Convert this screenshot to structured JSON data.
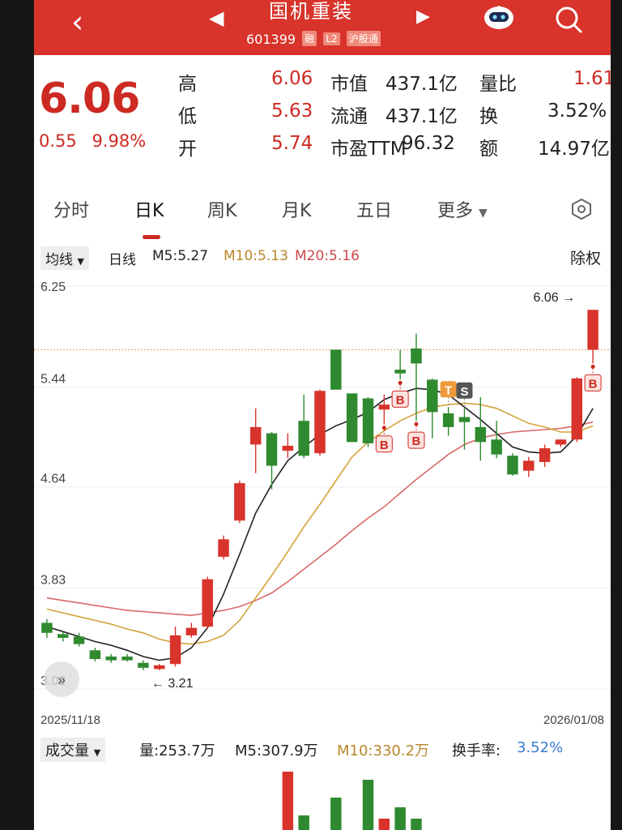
{
  "header": {
    "title": "国机重装",
    "code": "601399",
    "badges": [
      "融",
      "L2",
      "沪股通"
    ]
  },
  "quote": {
    "price": "6.06",
    "change": "0.55",
    "change_pct": "9.98%",
    "high_label": "高",
    "high": "6.06",
    "low_label": "低",
    "low": "5.63",
    "open_label": "开",
    "open": "5.74",
    "mktcap_label": "市值",
    "mktcap": "437.1亿",
    "float_label": "流通",
    "float": "437.1亿",
    "pe_label": "市盈TTM",
    "pe": "96.32",
    "volratio_label": "量比",
    "volratio": "1.61",
    "turnover_label": "换",
    "turnover": "3.52%",
    "amount_label": "额",
    "amount": "14.97亿"
  },
  "tabs": [
    "分时",
    "日K",
    "周K",
    "月K",
    "五日",
    "更多"
  ],
  "ma_bar": {
    "button": "均线",
    "period": "日线",
    "m5": "M5:5.27",
    "m10": "M10:5.13",
    "m20": "M20:5.16",
    "adjust": "除权"
  },
  "chart_data": {
    "type": "candlestick",
    "y_ticks": [
      "6.25",
      "5.44",
      "4.64",
      "3.83",
      "3.02"
    ],
    "ylim": [
      3.02,
      6.25
    ],
    "x_start_label": "2025/11/18",
    "x_end_label": "2026/01/08",
    "max_annotation": "6.06",
    "min_annotation": "3.21",
    "reference_line": 5.74,
    "candles": [
      {
        "o": 3.55,
        "c": 3.47,
        "h": 3.58,
        "l": 3.43
      },
      {
        "o": 3.46,
        "c": 3.43,
        "h": 3.48,
        "l": 3.4
      },
      {
        "o": 3.44,
        "c": 3.38,
        "h": 3.47,
        "l": 3.36
      },
      {
        "o": 3.33,
        "c": 3.26,
        "h": 3.35,
        "l": 3.24
      },
      {
        "o": 3.28,
        "c": 3.25,
        "h": 3.3,
        "l": 3.23
      },
      {
        "o": 3.28,
        "c": 3.25,
        "h": 3.3,
        "l": 3.24
      },
      {
        "o": 3.23,
        "c": 3.19,
        "h": 3.25,
        "l": 3.17
      },
      {
        "o": 3.18,
        "c": 3.21,
        "h": 3.22,
        "l": 3.17
      },
      {
        "o": 3.22,
        "c": 3.45,
        "h": 3.52,
        "l": 3.2
      },
      {
        "o": 3.45,
        "c": 3.51,
        "h": 3.55,
        "l": 3.43
      },
      {
        "o": 3.52,
        "c": 3.9,
        "h": 3.92,
        "l": 3.5
      },
      {
        "o": 4.08,
        "c": 4.22,
        "h": 4.25,
        "l": 4.06
      },
      {
        "o": 4.37,
        "c": 4.67,
        "h": 4.69,
        "l": 4.35
      },
      {
        "o": 4.98,
        "c": 5.12,
        "h": 5.27,
        "l": 4.75
      },
      {
        "o": 5.07,
        "c": 4.81,
        "h": 5.08,
        "l": 4.62
      },
      {
        "o": 4.93,
        "c": 4.97,
        "h": 5.07,
        "l": 4.87
      },
      {
        "o": 5.17,
        "c": 4.89,
        "h": 5.38,
        "l": 4.87
      },
      {
        "o": 4.91,
        "c": 5.41,
        "h": 5.42,
        "l": 4.89
      },
      {
        "o": 5.74,
        "c": 5.42,
        "h": 5.74,
        "l": 5.42
      },
      {
        "o": 5.39,
        "c": 5.0,
        "h": 5.39,
        "l": 5.0
      },
      {
        "o": 5.35,
        "c": 4.99,
        "h": 5.36,
        "l": 4.96
      },
      {
        "o": 5.26,
        "c": 5.3,
        "h": 5.38,
        "l": 5.14
      },
      {
        "o": 5.58,
        "c": 5.55,
        "h": 5.74,
        "l": 5.5
      },
      {
        "o": 5.75,
        "c": 5.63,
        "h": 5.87,
        "l": 5.17
      },
      {
        "o": 5.5,
        "c": 5.24,
        "h": 5.51,
        "l": 5.03
      },
      {
        "o": 5.23,
        "c": 5.12,
        "h": 5.28,
        "l": 5.05
      },
      {
        "o": 5.2,
        "c": 5.16,
        "h": 5.27,
        "l": 4.94
      },
      {
        "o": 5.12,
        "c": 5.0,
        "h": 5.36,
        "l": 4.85
      },
      {
        "o": 5.02,
        "c": 4.9,
        "h": 5.17,
        "l": 4.87
      },
      {
        "o": 4.89,
        "c": 4.74,
        "h": 4.91,
        "l": 4.73
      },
      {
        "o": 4.77,
        "c": 4.85,
        "h": 4.88,
        "l": 4.72
      },
      {
        "o": 4.84,
        "c": 4.95,
        "h": 4.98,
        "l": 4.8
      },
      {
        "o": 4.98,
        "c": 5.02,
        "h": 5.02,
        "l": 4.96
      },
      {
        "o": 5.02,
        "c": 5.51,
        "h": 5.52,
        "l": 5.0
      },
      {
        "o": 5.74,
        "c": 6.06,
        "h": 6.06,
        "l": 5.63
      }
    ],
    "ma5": [
      3.52,
      3.48,
      3.44,
      3.4,
      3.37,
      3.33,
      3.28,
      3.25,
      3.27,
      3.35,
      3.51,
      3.78,
      4.1,
      4.43,
      4.66,
      4.85,
      4.96,
      5.06,
      5.13,
      5.18,
      5.24,
      5.34,
      5.39,
      5.43,
      5.42,
      5.38,
      5.28,
      5.18,
      5.07,
      4.96,
      4.92,
      4.91,
      4.92,
      5.05,
      5.27
    ],
    "ma10": [
      3.66,
      3.63,
      3.6,
      3.57,
      3.54,
      3.5,
      3.47,
      3.42,
      3.39,
      3.38,
      3.4,
      3.45,
      3.57,
      3.75,
      3.93,
      4.12,
      4.32,
      4.5,
      4.69,
      4.88,
      5.0,
      5.09,
      5.17,
      5.23,
      5.28,
      5.3,
      5.31,
      5.3,
      5.27,
      5.21,
      5.15,
      5.12,
      5.08,
      5.08,
      5.13
    ],
    "ma20": [
      3.75,
      3.73,
      3.71,
      3.69,
      3.67,
      3.65,
      3.64,
      3.63,
      3.62,
      3.61,
      3.63,
      3.65,
      3.68,
      3.73,
      3.79,
      3.88,
      3.98,
      4.08,
      4.18,
      4.29,
      4.39,
      4.48,
      4.59,
      4.7,
      4.8,
      4.9,
      4.98,
      5.03,
      5.06,
      5.08,
      5.09,
      5.1,
      5.11,
      5.13,
      5.16
    ],
    "signals": [
      {
        "i": 21,
        "text": "B",
        "pos": "below"
      },
      {
        "i": 22,
        "text": "B",
        "pos": "below"
      },
      {
        "i": 23,
        "text": "B",
        "pos": "below"
      },
      {
        "i": 25,
        "text": "T",
        "pos": "above"
      },
      {
        "i": 26,
        "text": "S",
        "pos": "above"
      },
      {
        "i": 34,
        "text": "B",
        "pos": "below"
      }
    ],
    "colors": {
      "up": "#d8342b",
      "down": "#2f8a2f",
      "ma5": "#222222",
      "ma10": "#d4a23a",
      "ma20": "#d96a6a"
    }
  },
  "volume": {
    "button": "成交量",
    "vol": "量:253.7万",
    "m5": "M5:307.9万",
    "m10": "M10:330.2万",
    "turnover_label": "换手率:",
    "turnover": "3.52%"
  },
  "volume_data": [
    0,
    0,
    0,
    0,
    0,
    0,
    0,
    0,
    0,
    0,
    0,
    0,
    0,
    0,
    0,
    72,
    18,
    0,
    40,
    0,
    62,
    14,
    28,
    14,
    0,
    0,
    0,
    0,
    0,
    0,
    0,
    0,
    0,
    0,
    0
  ]
}
